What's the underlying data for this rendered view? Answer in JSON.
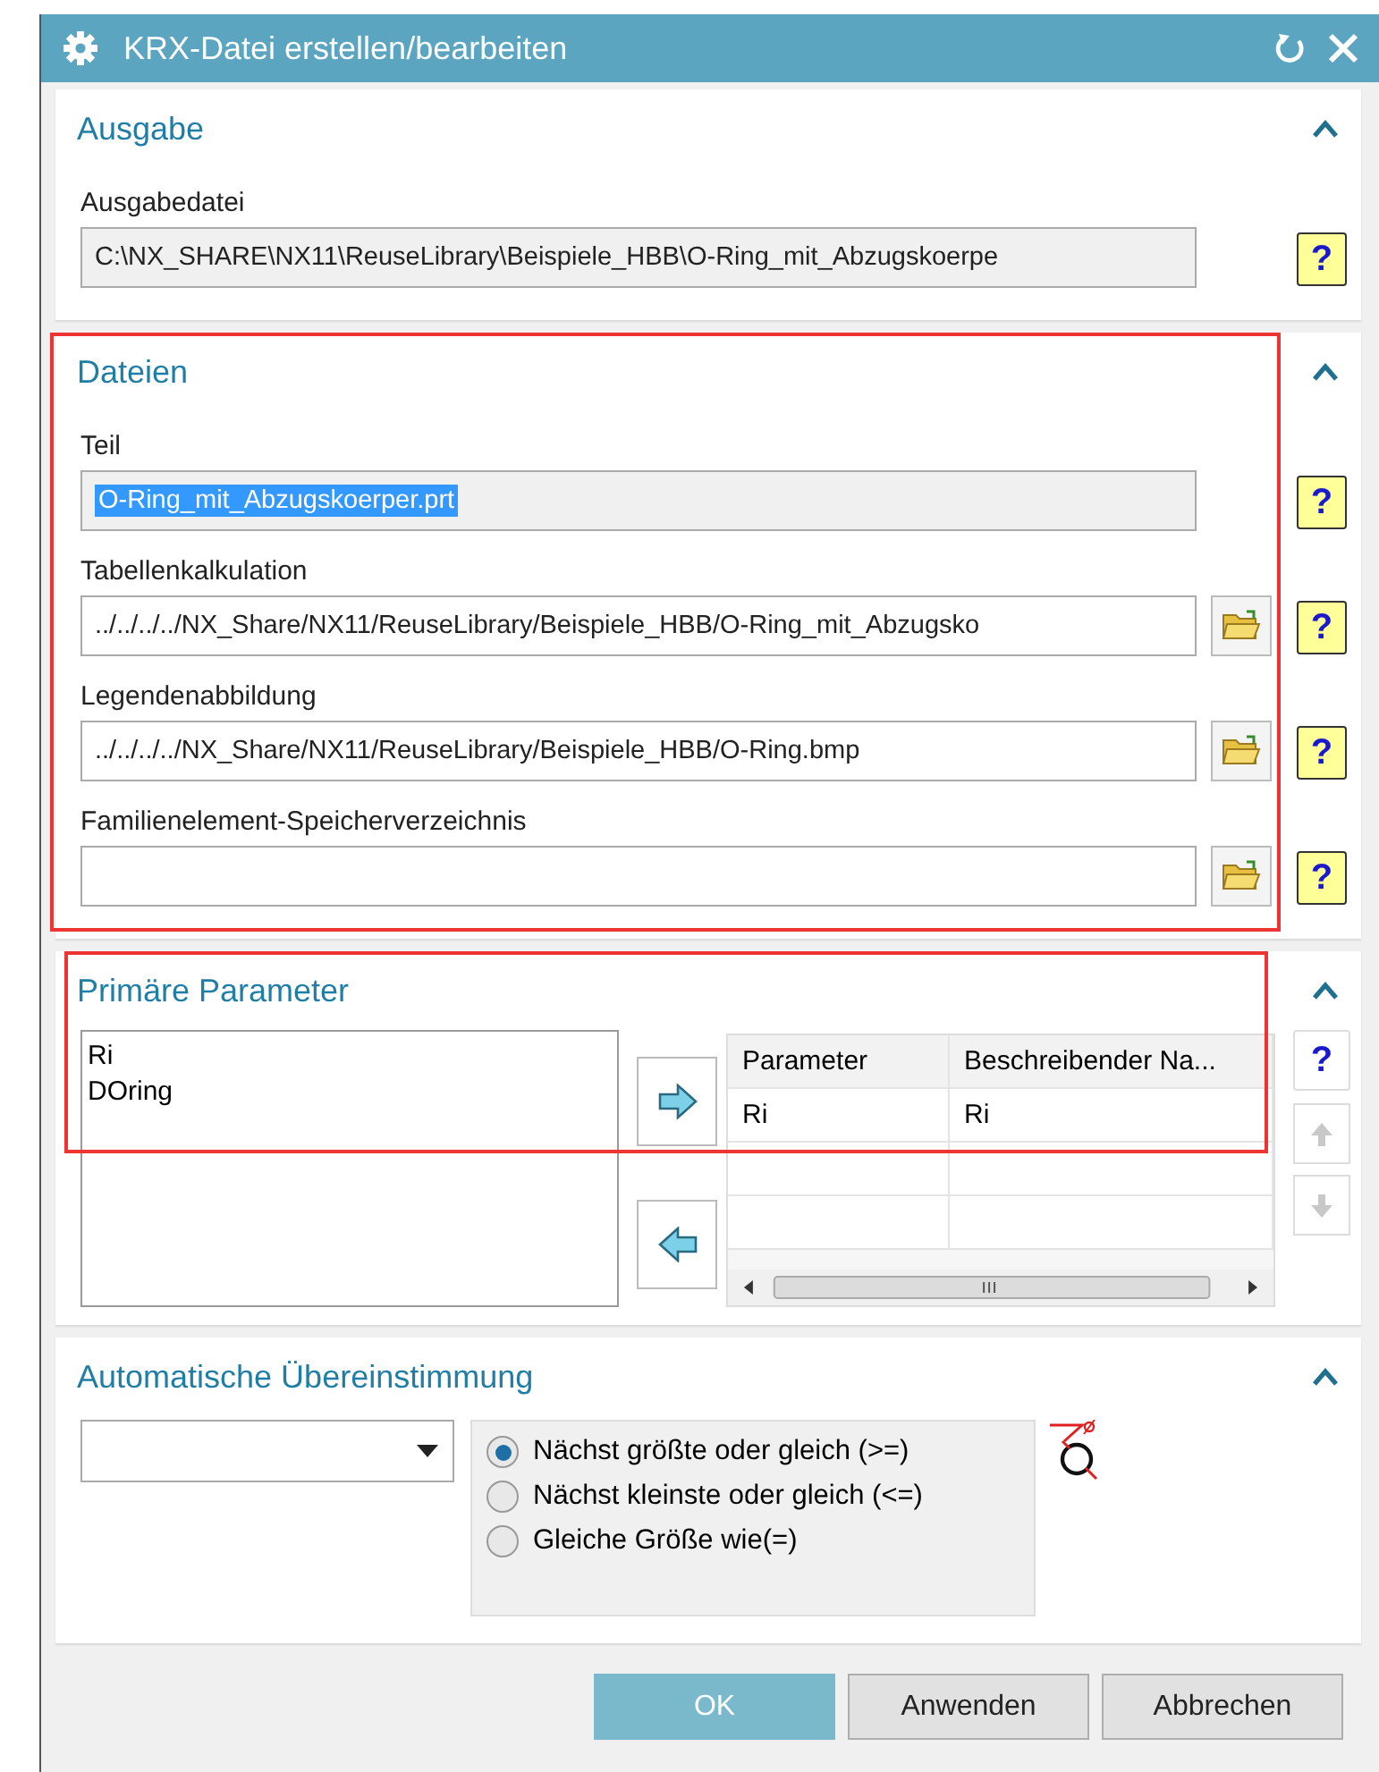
{
  "window": {
    "title": "KRX-Datei erstellen/bearbeiten"
  },
  "sections": [
    {
      "kind": "fields",
      "title": "Ausgabe",
      "expanded": true,
      "highlighted": false,
      "fields": [
        {
          "label": "Ausgabedatei",
          "value": "C:\\NX_SHARE\\NX11\\ReuseLibrary\\Beispiele_HBB\\O-Ring_mit_Abzugskoerpe",
          "readonly": true,
          "selected": false,
          "browse": false,
          "help": "?"
        }
      ]
    },
    {
      "kind": "fields",
      "title": "Dateien",
      "expanded": true,
      "highlighted": true,
      "fields": [
        {
          "label": "Teil",
          "value": "O-Ring_mit_Abzugskoerper.prt",
          "readonly": true,
          "selected": true,
          "browse": false,
          "help": "?"
        },
        {
          "label": "Tabellenkalkulation",
          "value": "../../../../NX_Share/NX11/ReuseLibrary/Beispiele_HBB/O-Ring_mit_Abzugsko",
          "readonly": false,
          "selected": false,
          "browse": true,
          "help": "?"
        },
        {
          "label": "Legendenabbildung",
          "value": "../../../../NX_Share/NX11/ReuseLibrary/Beispiele_HBB/O-Ring.bmp",
          "readonly": false,
          "selected": false,
          "browse": true,
          "help": "?"
        },
        {
          "label": "Familienelement-Speicherverzeichnis",
          "readonly": false,
          "selected": false,
          "browse": true,
          "help": "?"
        }
      ]
    },
    {
      "kind": "parameters",
      "title": "Primäre Parameter",
      "expanded": true,
      "highlighted": true,
      "available": [
        "Ri",
        "DOring"
      ],
      "table": {
        "columns": [
          "Parameter",
          "Beschreibender Na..."
        ],
        "rows": [
          [
            "Ri",
            "Ri"
          ]
        ]
      },
      "help": "?",
      "move_buttons": [
        {
          "kind": "up",
          "disabled": true
        },
        {
          "kind": "down",
          "disabled": true
        }
      ]
    },
    {
      "kind": "matching",
      "title": "Automatische Übereinstimmung",
      "expanded": true,
      "highlighted": false,
      "options": [
        {
          "label": "Nächst größte oder gleich (>=)",
          "selected": true
        },
        {
          "label": "Nächst kleinste oder gleich (<=)",
          "selected": false
        },
        {
          "label": "Gleiche Größe wie(=)",
          "selected": false
        }
      ]
    }
  ],
  "buttons": [
    {
      "label": "OK",
      "kind": "primary"
    },
    {
      "label": "Anwenden",
      "kind": "normal"
    },
    {
      "label": "Abbrechen",
      "kind": "normal"
    }
  ]
}
